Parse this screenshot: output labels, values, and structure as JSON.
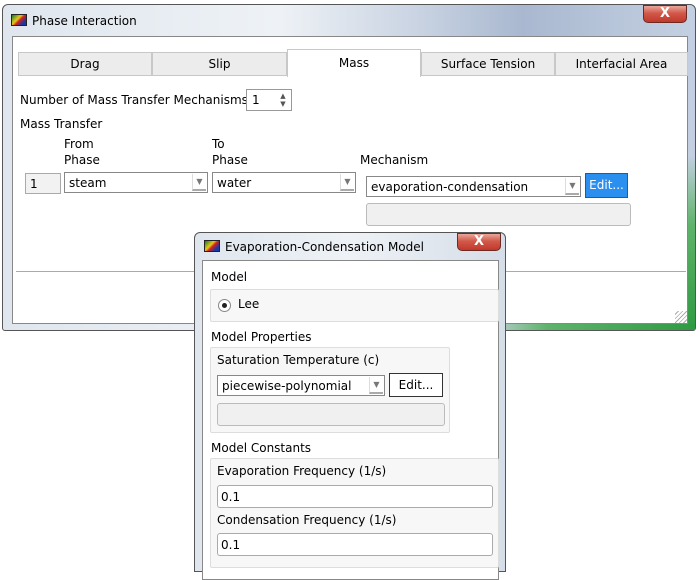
{
  "main_window": {
    "title": "Phase Interaction",
    "icon": "fluent-app-icon",
    "close_glyph": "X",
    "tabs": [
      {
        "label": "Drag",
        "active": false
      },
      {
        "label": "Slip",
        "active": false
      },
      {
        "label": "Mass",
        "active": true
      },
      {
        "label": "Surface Tension",
        "active": false
      },
      {
        "label": "Interfacial Area",
        "active": false
      }
    ],
    "num_mechanisms_label": "Number of Mass Transfer Mechanisms",
    "num_mechanisms_value": "1",
    "spin_up": "▲",
    "spin_down": "▼",
    "mass_transfer_label": "Mass Transfer",
    "columns": {
      "from_line1": "From",
      "from_line2": "Phase",
      "to_line1": "To",
      "to_line2": "Phase",
      "mechanism": "Mechanism"
    },
    "rows": [
      {
        "index": "1",
        "from_phase": "steam",
        "to_phase": "water",
        "mechanism": "evaporation-condensation",
        "edit_label": "Edit..."
      }
    ],
    "dropdown_glyph": "▼"
  },
  "evap_dialog": {
    "title": "Evaporation-Condensation Model",
    "close_glyph": "X",
    "model_label": "Model",
    "model_options": [
      {
        "label": "Lee",
        "selected": true
      }
    ],
    "properties_label": "Model Properties",
    "saturation_temp_label": "Saturation Temperature (c)",
    "saturation_temp_method": "piecewise-polynomial",
    "saturation_edit_label": "Edit...",
    "constants_label": "Model Constants",
    "evaporation_freq_label": "Evaporation Frequency (1/s)",
    "evaporation_freq_value": "0.1",
    "condensation_freq_label": "Condensation Frequency (1/s)",
    "condensation_freq_value": "0.1"
  }
}
